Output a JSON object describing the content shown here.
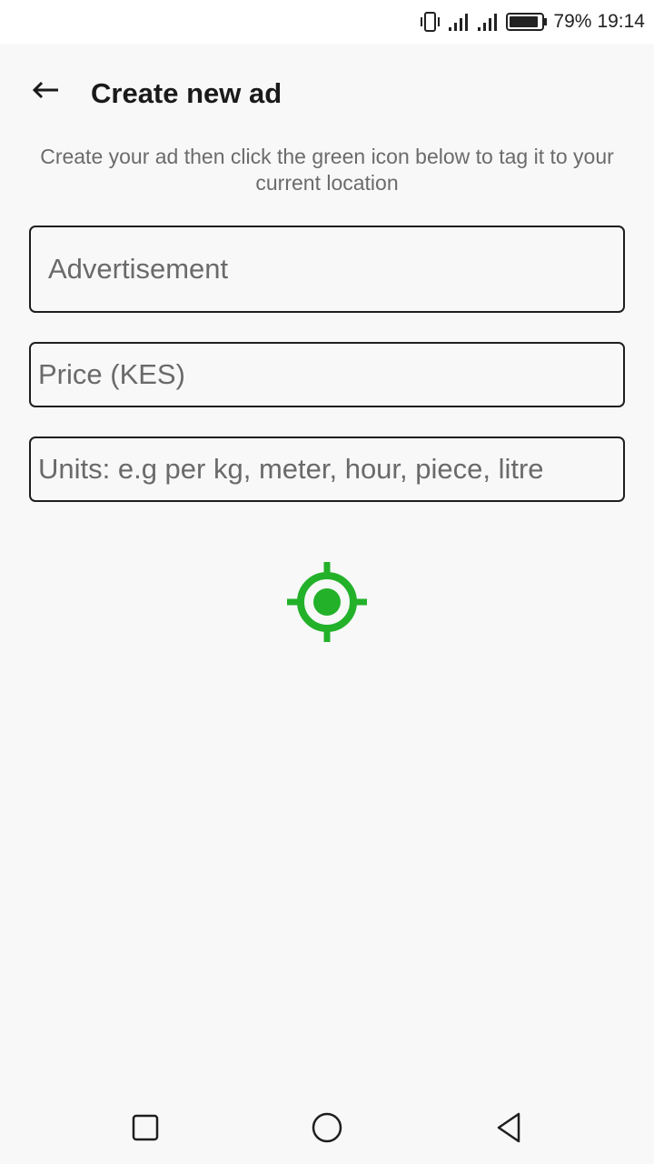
{
  "status_bar": {
    "battery_percent": "79%",
    "time": "19:14",
    "icons": [
      "vibrate-icon",
      "signal-icon",
      "signal-icon",
      "battery-icon"
    ]
  },
  "app_bar": {
    "title": "Create new ad",
    "back_icon": "arrow-left-icon"
  },
  "instructions": "Create your ad then click the green icon below to tag it to your current location",
  "form": {
    "advertisement_placeholder": "Advertisement",
    "advertisement_value": "",
    "price_placeholder": "Price (KES)",
    "price_value": "",
    "units_placeholder": "Units: e.g per kg, meter, hour, piece, litre",
    "units_value": ""
  },
  "location_button": {
    "icon": "gps-crosshair-icon",
    "color": "#23b12a"
  },
  "nav_bar": {
    "icons": [
      "recent-apps-icon",
      "home-icon",
      "back-icon"
    ]
  }
}
